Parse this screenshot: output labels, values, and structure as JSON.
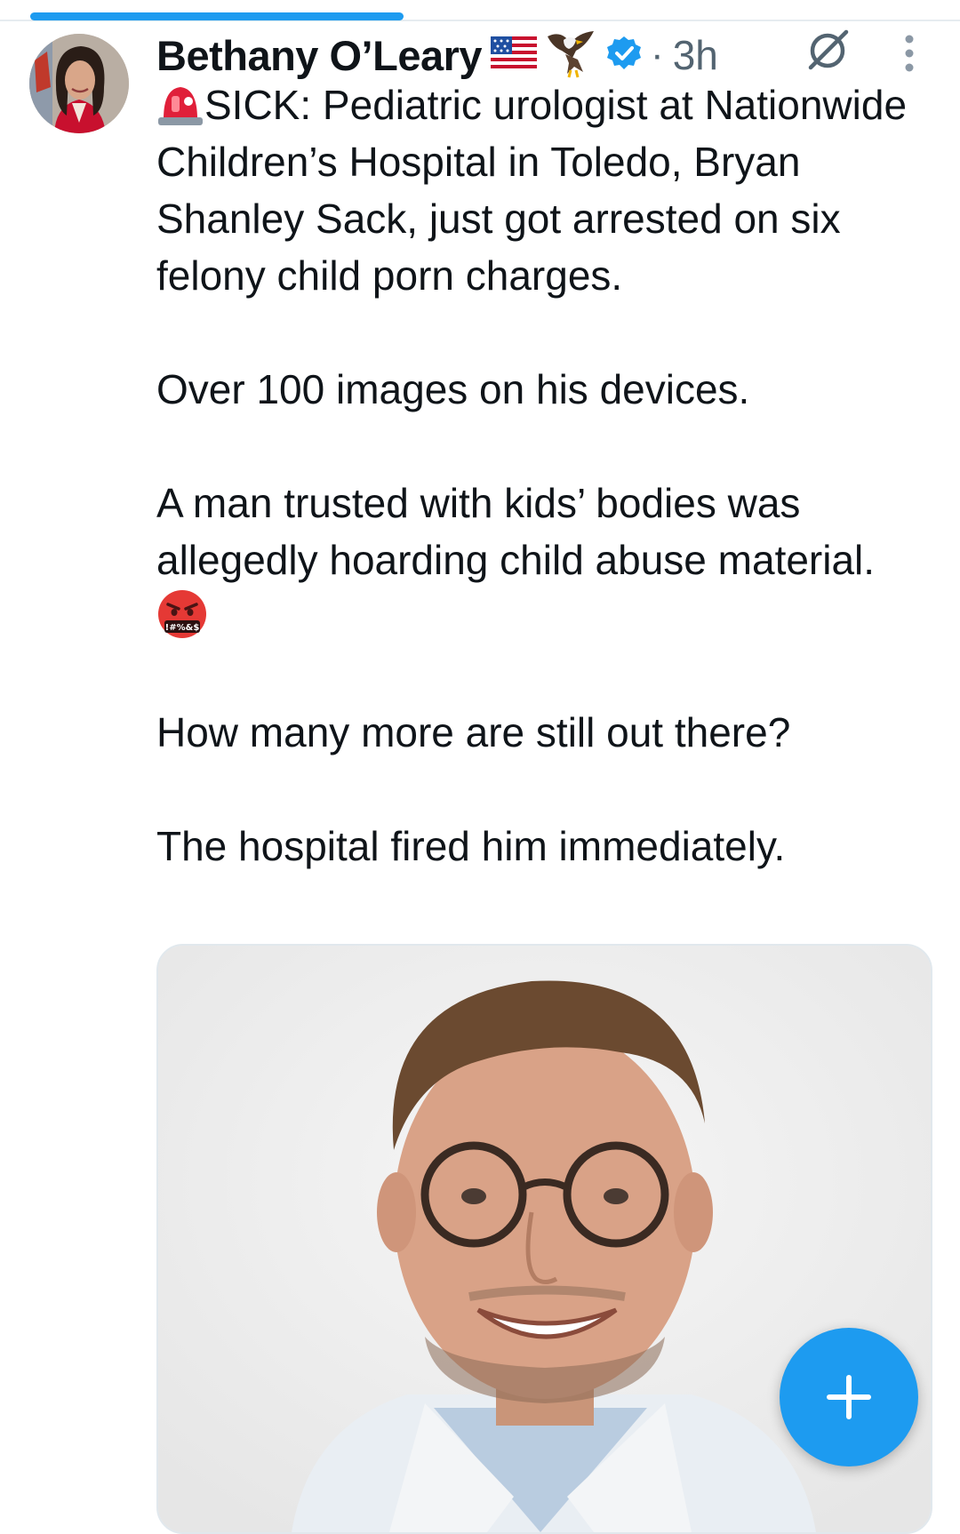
{
  "app": {
    "accent_color": "#1d9bf0"
  },
  "tweet": {
    "author": {
      "display_name": "Bethany O’Leary",
      "badges": [
        "us-flag-emoji",
        "eagle-emoji",
        "verified-badge"
      ]
    },
    "separator": "·",
    "timestamp": "3h",
    "paragraphs": [
      "SICK: Pediatric urologist at Nationwide Children’s Hospital in Toledo, Bryan Shanley Sack, just got arrested on six felony child porn charges.",
      "Over 100 images on his devices.",
      "A man trusted with kids’ bodies was allegedly hoarding child abuse material.",
      "How many more are still out there?",
      "The hospital fired him immediately."
    ],
    "media_badge_text": "!#%&$"
  },
  "icons": {
    "lead_emoji": "police-light-emoji",
    "anger_emoji": "face-with-symbols-emoji",
    "grok": "grok-icon",
    "more": "more-vertical-icon",
    "compose": "plus-icon"
  }
}
